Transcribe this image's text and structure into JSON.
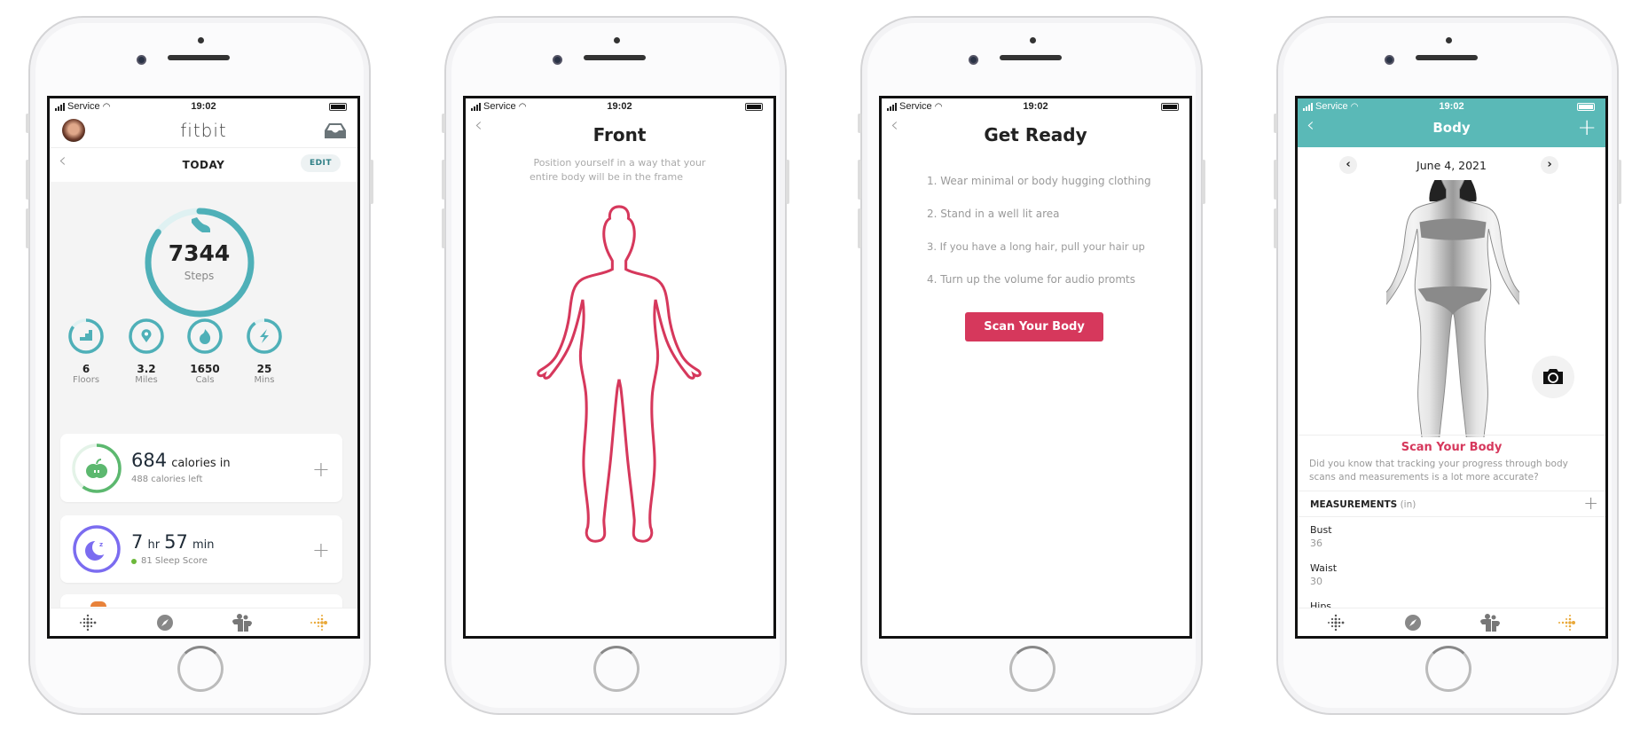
{
  "colors": {
    "teal": "#4fb0b8",
    "header_teal": "#5ab9b7",
    "accent_red": "#d6385c",
    "green": "#5cb86f",
    "purple": "#7b6cf0",
    "orange": "#e9a93a"
  },
  "status_bar": {
    "carrier": "Service",
    "time": "19:02",
    "icons": [
      "signal-icon",
      "wifi-icon",
      "battery-icon"
    ]
  },
  "phone1": {
    "app_title": "fitbit",
    "date_label": "TODAY",
    "edit_label": "EDIT",
    "steps": {
      "value": "7344",
      "label": "Steps",
      "progress": 0.85
    },
    "stats": [
      {
        "value": "6",
        "label": "Floors",
        "icon": "stairs-icon",
        "progress": 0.85
      },
      {
        "value": "3.2",
        "label": "Miles",
        "icon": "location-pin-icon",
        "progress": 1
      },
      {
        "value": "1650",
        "label": "Cals",
        "icon": "flame-icon",
        "progress": 1
      },
      {
        "value": "25",
        "label": "Mins",
        "icon": "lightning-icon",
        "progress": 0.9
      }
    ],
    "calories_card": {
      "value": "684",
      "unit": "calories in",
      "sub": "488 calories left",
      "progress": 0.6
    },
    "sleep_card": {
      "hours": "7",
      "hr_unit": "hr",
      "minutes": "57",
      "min_unit": "min",
      "score": "81 Sleep Score"
    }
  },
  "phone2": {
    "title": "Front",
    "subtitle_line1": "Position yourself  in a way that your",
    "subtitle_line2": "entire body will be in the frame"
  },
  "phone3": {
    "title": "Get Ready",
    "steps": [
      "1. Wear minimal or body hugging clothing",
      "2. Stand in a well lit area",
      "3. If you have a long hair, pull your hair up",
      "4. Turn up the volume for audio promts"
    ],
    "button": "Scan Your Body"
  },
  "phone4": {
    "title": "Body",
    "date": "June 4, 2021",
    "scan_title": "Scan Your Body",
    "scan_desc_line1": "Did you know that tracking your progress through body",
    "scan_desc_line2": "scans and measurements is a lot more accurate?",
    "measurements_label": "MEASUREMENTS",
    "measurements_unit": "(in)",
    "measurements": [
      {
        "name": "Bust",
        "value": "36"
      },
      {
        "name": "Waist",
        "value": "30"
      },
      {
        "name": "Hips",
        "value": ""
      }
    ]
  },
  "bottom_nav": [
    "today-icon",
    "discover-icon",
    "community-icon",
    "premium-icon"
  ]
}
